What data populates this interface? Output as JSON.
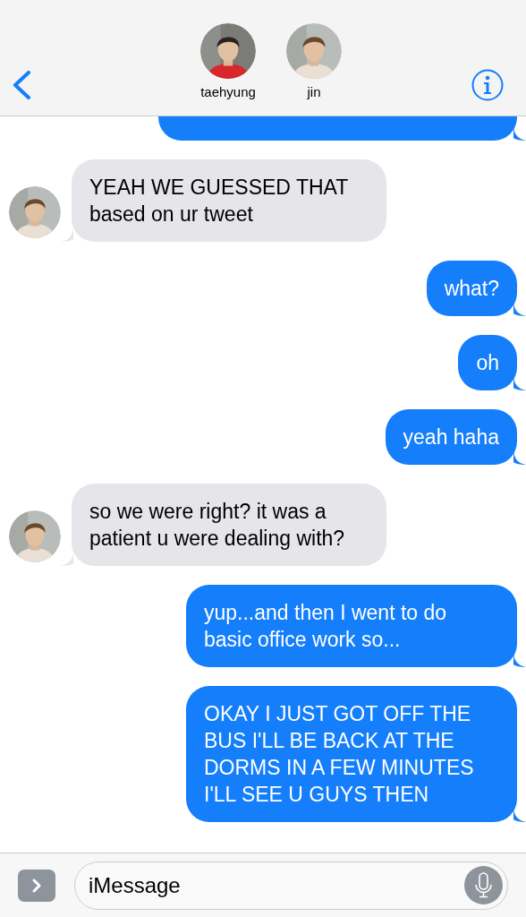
{
  "header": {
    "participants": [
      {
        "name": "taehyung",
        "kind": "picture"
      },
      {
        "name": "jin",
        "kind": "picture"
      }
    ]
  },
  "messages": [
    {
      "kind": "sent",
      "cut_off": true
    },
    {
      "kind": "received",
      "text": "YEAH WE GUESSED THAT based on ur tweet"
    },
    {
      "kind": "sent",
      "text": "what?"
    },
    {
      "kind": "sent",
      "text": "oh"
    },
    {
      "kind": "sent",
      "text": "yeah haha"
    },
    {
      "kind": "received",
      "text": "so we were right? it was a patient u were dealing with?"
    },
    {
      "kind": "sent",
      "text": "yup...and then I went to do basic office work so..."
    },
    {
      "kind": "sent",
      "text": "OKAY I JUST GOT OFF THE BUS I'LL BE BACK AT THE DORMS IN A FEW MINUTES I'LL SEE U GUYS THEN"
    }
  ],
  "composer": {
    "placeholder": "iMessage"
  }
}
